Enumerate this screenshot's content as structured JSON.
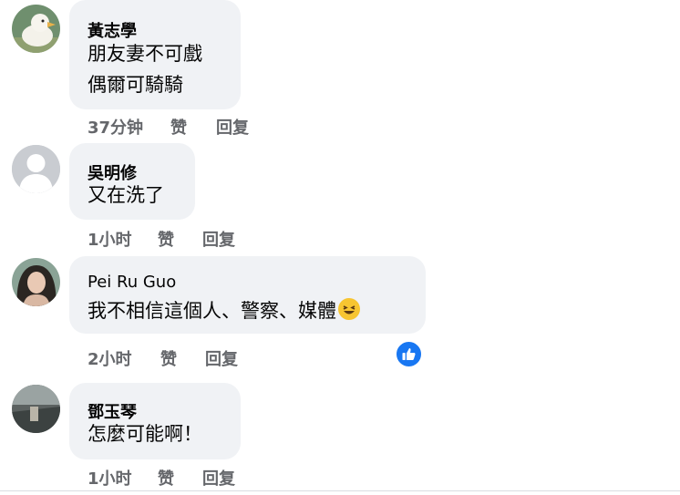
{
  "comments": [
    {
      "name": "黃志學",
      "lines": [
        "朋友妻不可戲",
        "偶爾可騎騎"
      ],
      "time": "37分钟",
      "like": "赞",
      "reply": "回复"
    },
    {
      "name": "吳明修",
      "lines": [
        "又在洗了"
      ],
      "time": "1小时",
      "like": "赞",
      "reply": "回复"
    },
    {
      "name": "Pei Ru Guo",
      "lines": [
        "我不相信這個人、警察、媒體"
      ],
      "time": "2小时",
      "like": "赞",
      "reply": "回复",
      "emoji": "laughing-face",
      "reaction": "like-icon"
    },
    {
      "name": "鄧玉琴",
      "lines": [
        "怎麼可能啊！"
      ],
      "time": "1小时",
      "like": "赞",
      "reply": "回复"
    }
  ],
  "colors": {
    "bubble": "#f0f2f5",
    "meta_text": "#65676b",
    "like_blue": "#1877f2"
  }
}
